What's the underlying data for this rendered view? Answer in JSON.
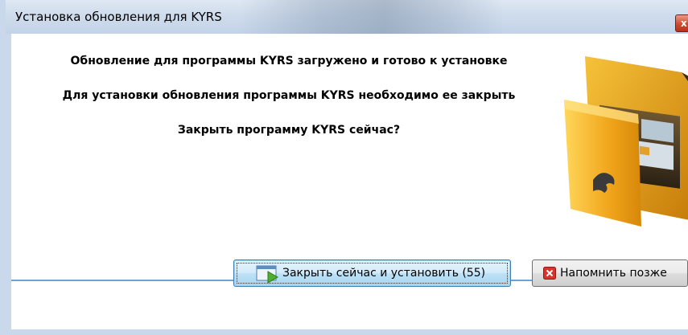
{
  "window": {
    "title": "Установка обновления для KYRS",
    "close_glyph": "x"
  },
  "message": {
    "line1": "Обновление для программы KYRS загружено и готово к установке",
    "line2": "Для установки обновления программы KYRS необходимо ее закрыть",
    "line3": "Закрыть программу KYRS сейчас?"
  },
  "buttons": {
    "install_now": "Закрыть сейчас и установить (55)",
    "remind_later": "Напомнить позже"
  },
  "colors": {
    "frame": "#c9d8ea",
    "separator": "#6aa4d8",
    "close": "#d2492f"
  },
  "icons": {
    "folder": "folder-icon",
    "install": "window-play-icon",
    "remind": "red-x-icon"
  }
}
